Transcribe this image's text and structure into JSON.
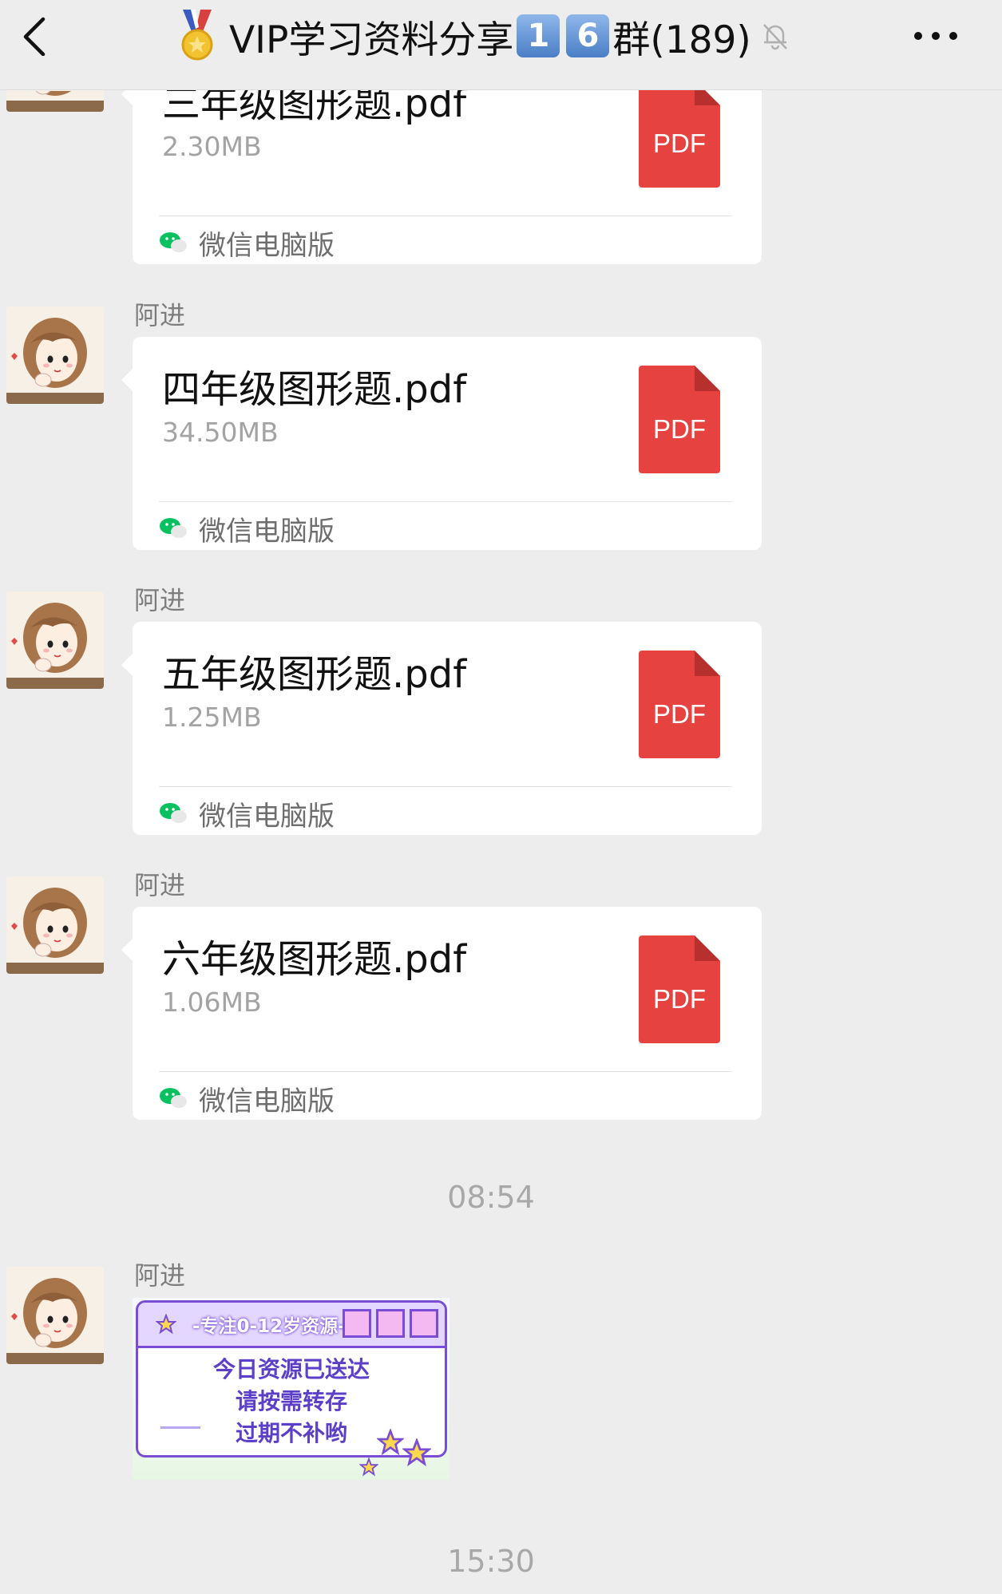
{
  "header": {
    "title_prefix": "VIP学习资料分享",
    "digit1": "1",
    "digit2": "6",
    "title_suffix": "群(189)"
  },
  "messages": [
    {
      "sender": "",
      "file_name": "三年级图形题.pdf",
      "file_size": "2.30MB",
      "file_type": "PDF",
      "source": "微信电脑版"
    },
    {
      "sender": "阿进",
      "file_name": "四年级图形题.pdf",
      "file_size": "34.50MB",
      "file_type": "PDF",
      "source": "微信电脑版"
    },
    {
      "sender": "阿进",
      "file_name": "五年级图形题.pdf",
      "file_size": "1.25MB",
      "file_type": "PDF",
      "source": "微信电脑版"
    },
    {
      "sender": "阿进",
      "file_name": "六年级图形题.pdf",
      "file_size": "1.06MB",
      "file_type": "PDF",
      "source": "微信电脑版"
    }
  ],
  "timestamps": [
    "08:54",
    "15:30"
  ],
  "image_message": {
    "sender": "阿进",
    "banner_title": "-专注0-12岁资源-",
    "lines": [
      "今日资源已送达",
      "请按需转存",
      "过期不补哟"
    ]
  },
  "colors": {
    "background": "#ededed",
    "bubble": "#ffffff",
    "pdf_red": "#e64340",
    "wechat_green": "#07c160",
    "accent_purple": "#7a4dd6"
  },
  "icons": [
    "back-arrow-icon",
    "medal-icon",
    "mute-bell-icon",
    "more-dots-icon",
    "pdf-file-icon",
    "wechat-icon"
  ]
}
